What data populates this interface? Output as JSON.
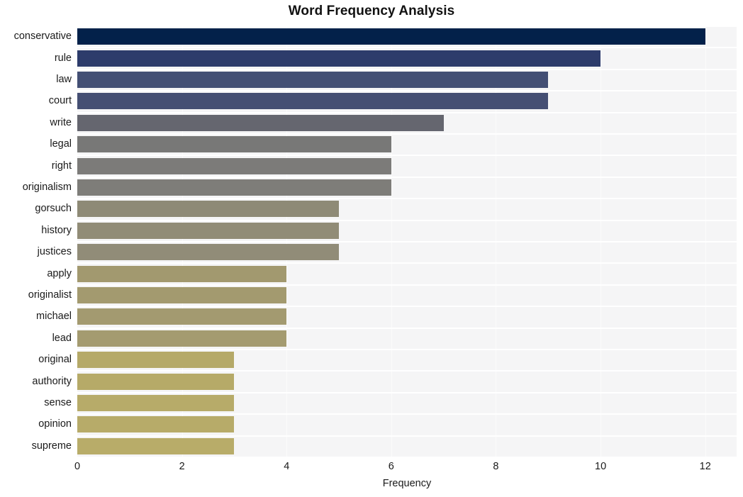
{
  "chart_data": {
    "type": "bar",
    "orientation": "horizontal",
    "title": "Word Frequency Analysis",
    "xlabel": "Frequency",
    "ylabel": "",
    "xlim": [
      0,
      12.6
    ],
    "xticks": [
      0,
      2,
      4,
      6,
      8,
      10,
      12
    ],
    "xtick_labels": [
      "0",
      "2",
      "4",
      "6",
      "8",
      "10",
      "12"
    ],
    "grid": true,
    "grid_axis": "both",
    "legend": null,
    "categories": [
      "conservative",
      "rule",
      "law",
      "court",
      "write",
      "legal",
      "right",
      "originalism",
      "gorsuch",
      "history",
      "justices",
      "apply",
      "originalist",
      "michael",
      "lead",
      "original",
      "authority",
      "sense",
      "opinion",
      "supreme"
    ],
    "values": [
      12,
      10,
      9,
      9,
      7,
      6,
      6,
      6,
      5,
      5,
      5,
      4,
      4,
      4,
      4,
      3,
      3,
      3,
      3,
      3
    ],
    "bar_colors": [
      "#03214a",
      "#2d3c6b",
      "#434f74",
      "#454f73",
      "#65666f",
      "#787877",
      "#7c7b79",
      "#7e7d79",
      "#8e8a76",
      "#918c77",
      "#918c78",
      "#a2996f",
      "#a39a6f",
      "#a39a70",
      "#a49b70",
      "#b5a968",
      "#b6aa68",
      "#b7ab69",
      "#b7ab69",
      "#b8ac69"
    ],
    "plot_bgcolor": "#f5f5f6",
    "figure_bgcolor": "#ffffff",
    "gridline_color": "#ffffff",
    "text_color": "#1a1a1a",
    "colormap": "cividis-like (dark navy to khaki)"
  }
}
